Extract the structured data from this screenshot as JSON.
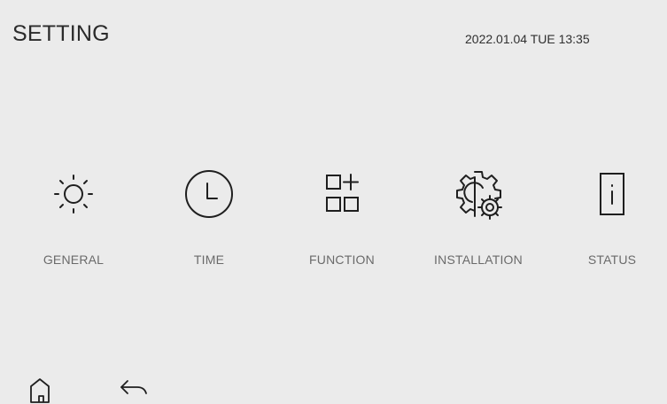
{
  "header": {
    "title": "SETTING",
    "datetime": "2022.01.04 TUE 13:35"
  },
  "menu": [
    {
      "label": "GENERAL",
      "icon": "sun-icon"
    },
    {
      "label": "TIME",
      "icon": "clock-icon"
    },
    {
      "label": "FUNCTION",
      "icon": "grid-plus-icon"
    },
    {
      "label": "INSTALLATION",
      "icon": "gears-icon"
    },
    {
      "label": "STATUS",
      "icon": "info-icon"
    }
  ],
  "footer": {
    "home_icon": "home-icon",
    "back_icon": "back-arrow-icon"
  },
  "colors": {
    "background": "#ebebeb",
    "text": "#2b2b2b",
    "label": "#6a6a6a",
    "icon_stroke": "#1f1f1f"
  }
}
